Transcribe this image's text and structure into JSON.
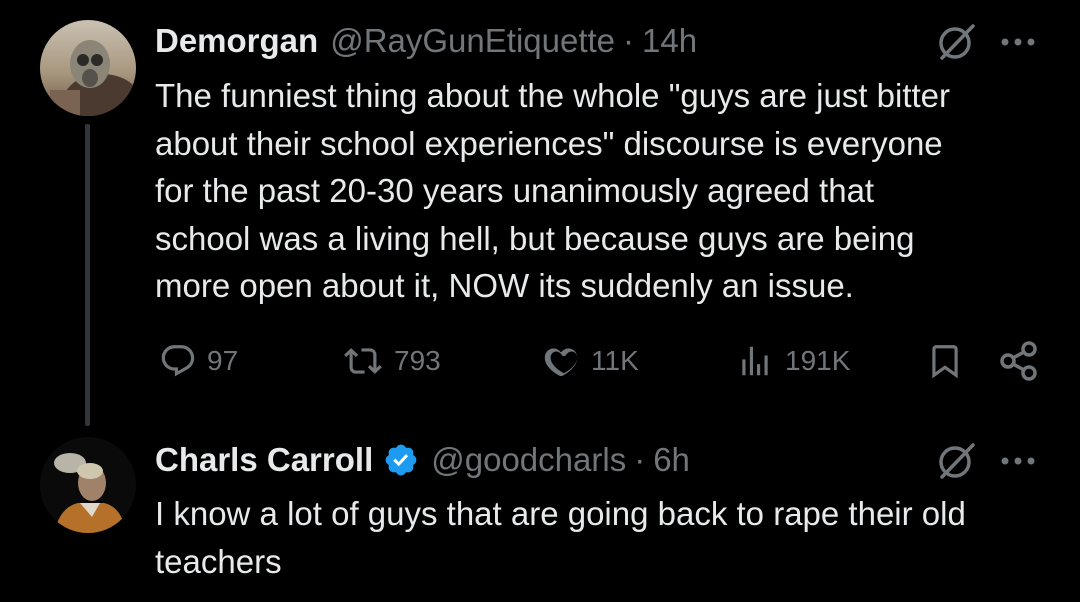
{
  "tweets": [
    {
      "name": "Demorgan",
      "handle": "@RayGunEtiquette",
      "separator": "·",
      "time": "14h",
      "verified": false,
      "text": "The funniest thing about the whole \"guys are just bitter\nabout their school experiences\" discourse is everyone\nfor the past 20-30 years unanimously agreed that\nschool was a living hell, but because guys are being\nmore open about it, NOW its suddenly an issue.",
      "stats": {
        "replies": "97",
        "reposts": "793",
        "likes": "11K",
        "views": "191K"
      }
    },
    {
      "name": "Charls Carroll",
      "handle": "@goodcharls",
      "separator": "·",
      "time": "6h",
      "verified": true,
      "text": "I know a lot of guys that are going back to rape their old\nteachers"
    }
  ],
  "icons": {
    "reply": "reply-icon",
    "repost": "repost-icon",
    "like": "heart-icon",
    "views": "views-icon",
    "bookmark": "bookmark-icon",
    "share": "share-icon",
    "grok": "grok-icon",
    "more": "more-icon",
    "verified": "verified-badge-icon"
  },
  "colors": {
    "background": "#000000",
    "primary_text": "#e7e9ea",
    "secondary_text": "#71767b",
    "verified_blue": "#1d9bf0",
    "thread_line": "#333639"
  }
}
